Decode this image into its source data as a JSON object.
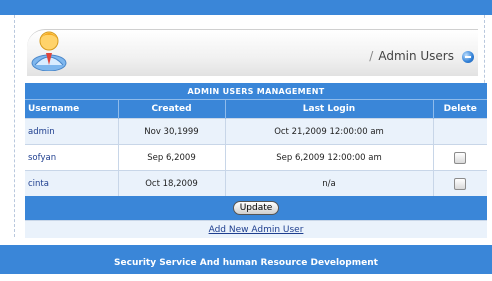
{
  "breadcrumb": {
    "separator": "/",
    "label": "Admin Users"
  },
  "table": {
    "title": "ADMIN USERS MANAGEMENT",
    "columns": [
      "Username",
      "Created",
      "Last Login",
      "Delete"
    ],
    "rows": [
      {
        "username": "admin",
        "created": "Nov 30,1999",
        "last_login": "Oct 21,2009 12:00:00 am",
        "deletable": false
      },
      {
        "username": "sofyan",
        "created": "Sep 6,2009",
        "last_login": "Sep 6,2009 12:00:00 am",
        "deletable": true
      },
      {
        "username": "cinta",
        "created": "Oct 18,2009",
        "last_login": "n/a",
        "deletable": true
      }
    ],
    "update_label": "Update",
    "add_link": "Add New Admin User"
  },
  "footer": {
    "text": "Security Service And human Resource Development"
  },
  "colors": {
    "accent": "#3a86d8",
    "row_alt": "#eaf2fb",
    "link": "#1f3f8f"
  },
  "icons": {
    "header": "admin-user-avatar-icon",
    "help": "help-circle-icon"
  }
}
